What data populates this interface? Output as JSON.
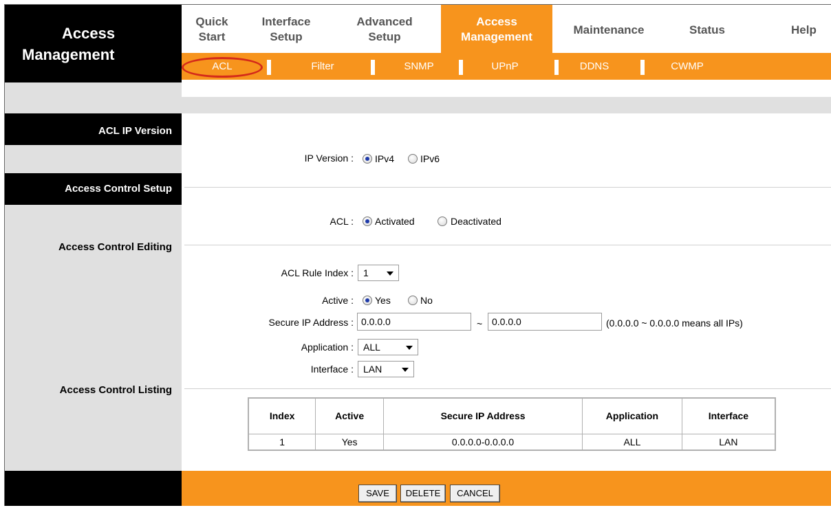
{
  "brand": {
    "line1": "Access",
    "line2": "Management"
  },
  "topnav": [
    {
      "l1": "Quick",
      "l2": "Start"
    },
    {
      "l1": "Interface",
      "l2": "Setup"
    },
    {
      "l1": "Advanced",
      "l2": "Setup"
    },
    {
      "l1": "Access",
      "l2": "Management"
    },
    {
      "l1": "Maintenance",
      "l2": ""
    },
    {
      "l1": "Status",
      "l2": ""
    },
    {
      "l1": "Help",
      "l2": ""
    }
  ],
  "subnav": [
    "ACL",
    "Filter",
    "SNMP",
    "UPnP",
    "DDNS",
    "CWMP"
  ],
  "sections": {
    "ip_version": "ACL IP Version",
    "setup": "Access Control Setup",
    "editing": "Access Control Editing",
    "listing": "Access Control Listing"
  },
  "form": {
    "ip_version_label": "IP Version :",
    "ipv4": "IPv4",
    "ipv6": "IPv6",
    "acl_label": "ACL :",
    "activated": "Activated",
    "deactivated": "Deactivated",
    "rule_index_label": "ACL Rule Index :",
    "rule_index_value": "1",
    "active_label": "Active :",
    "yes": "Yes",
    "no": "No",
    "secure_ip_label": "Secure IP Address :",
    "ip_start": "0.0.0.0",
    "tilde": "~",
    "ip_end": "0.0.0.0",
    "ip_hint": "(0.0.0.0 ~ 0.0.0.0 means all IPs)",
    "application_label": "Application :",
    "application_value": "ALL",
    "interface_label": "Interface :",
    "interface_value": "LAN"
  },
  "table": {
    "headers": [
      "Index",
      "Active",
      "Secure IP Address",
      "Application",
      "Interface"
    ],
    "rows": [
      [
        "1",
        "Yes",
        "0.0.0.0-0.0.0.0",
        "ALL",
        "LAN"
      ]
    ]
  },
  "buttons": {
    "save": "SAVE",
    "delete": "DELETE",
    "cancel": "CANCEL"
  },
  "colors": {
    "accent": "#f7941d",
    "highlight_circle": "#d42a1a"
  }
}
